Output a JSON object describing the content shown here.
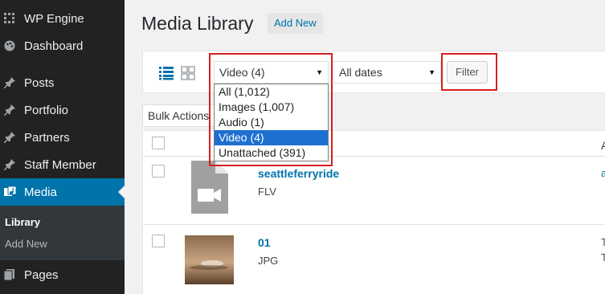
{
  "sidebar": {
    "items": [
      {
        "label": "WP Engine",
        "icon": "grid-icon"
      },
      {
        "label": "Dashboard",
        "icon": "palette-icon"
      },
      {
        "label": "Posts",
        "icon": "pin-icon"
      },
      {
        "label": "Portfolio",
        "icon": "pin-icon"
      },
      {
        "label": "Partners",
        "icon": "pin-icon"
      },
      {
        "label": "Staff Member",
        "icon": "pin-icon"
      },
      {
        "label": "Media",
        "icon": "media-icon"
      },
      {
        "label": "Pages",
        "icon": "pages-icon"
      }
    ],
    "submenu": [
      {
        "label": "Library"
      },
      {
        "label": "Add New"
      }
    ]
  },
  "header": {
    "title": "Media Library",
    "add_new": "Add New"
  },
  "filters": {
    "type_select": "Video (4)",
    "date_select": "All dates",
    "filter_button": "Filter",
    "type_options": [
      "All (1,012)",
      "Images (1,007)",
      "Audio (1)",
      "Video (4)",
      "Unattached (391)"
    ],
    "selected_option": "Video (4)"
  },
  "bulk_actions": "Bulk Actions",
  "table": {
    "header_letter": "A",
    "rows": [
      {
        "title": "seattleferryride",
        "type": "FLV",
        "edge": "a"
      },
      {
        "title": "01",
        "type": "JPG",
        "edge1": "T",
        "edge2": "T"
      }
    ]
  },
  "colors": {
    "sidebar_bg": "#222222",
    "active_bg": "#0073aa",
    "highlight": "#d62020",
    "selected_option_bg": "#1e70d0",
    "link": "#0073aa"
  }
}
